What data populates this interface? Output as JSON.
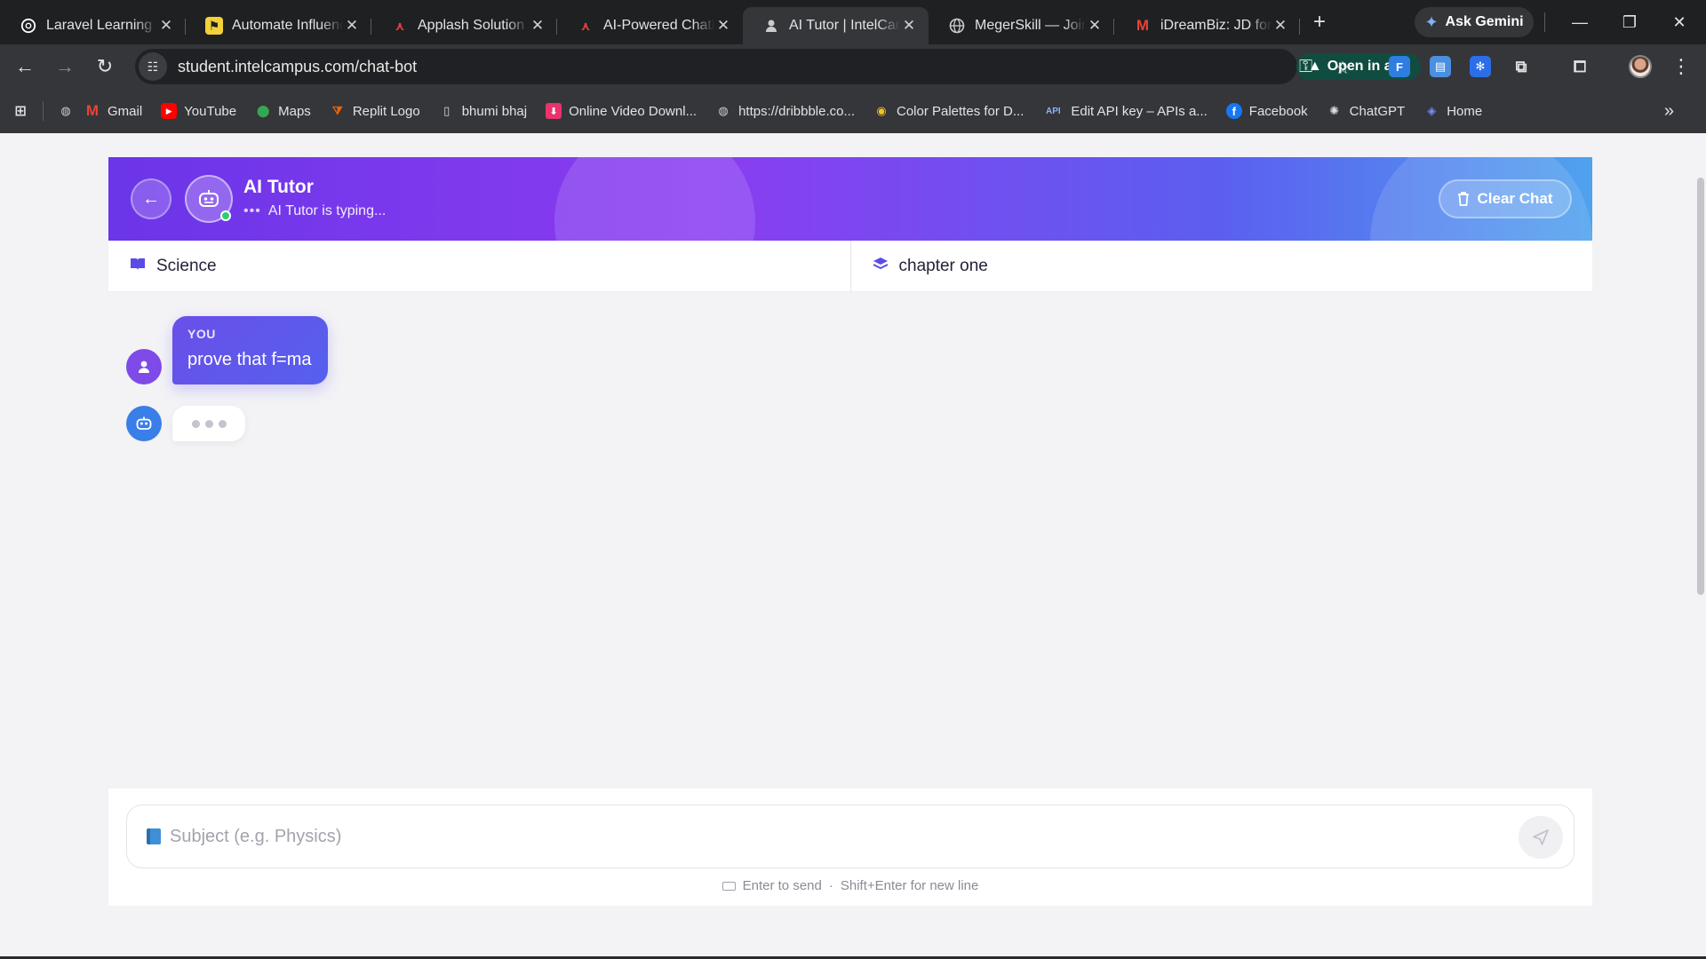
{
  "browser": {
    "tabs": [
      {
        "title": "Laravel Learning - ",
        "favicon": "chatgpt-icon",
        "color": "#ffffff"
      },
      {
        "title": "Automate Influenc",
        "favicon": "flag-icon",
        "color": "#f2d13a"
      },
      {
        "title": "Applash Solution - ",
        "favicon": "applash-icon",
        "color": "#e0413a"
      },
      {
        "title": "AI-Powered Chatb",
        "favicon": "applash-icon",
        "color": "#e0413a"
      },
      {
        "title": "AI Tutor | IntelCam",
        "favicon": "incognito-icon",
        "color": "#cccccc",
        "active": true
      },
      {
        "title": "MegerSkill — Join",
        "favicon": "globe-icon",
        "color": "#cccccc"
      },
      {
        "title": "iDreamBiz: JD for ",
        "favicon": "gmail-icon",
        "color": "#ea4335"
      }
    ],
    "gemini_label": "Ask Gemini",
    "url": "student.intelcampus.com/chat-bot",
    "open_in_app_label": "Open in app",
    "bookmarks": [
      {
        "label": "Gmail",
        "icon": "gmail-icon",
        "color": "#ea4335"
      },
      {
        "label": "YouTube",
        "icon": "youtube-icon",
        "color": "#ff0000"
      },
      {
        "label": "Maps",
        "icon": "maps-pin-icon",
        "color": "#34a853"
      },
      {
        "label": "Replit Logo",
        "icon": "replit-icon",
        "color": "#f26207"
      },
      {
        "label": "bhumi bhaj",
        "icon": "document-icon",
        "color": "#dddddd"
      },
      {
        "label": "Online Video Downl...",
        "icon": "download-icon",
        "color": "#e8336d"
      },
      {
        "label": "https://dribbble.co...",
        "icon": "globe-icon",
        "color": "#cccccc"
      },
      {
        "label": "Color Palettes for D...",
        "icon": "palette-icon",
        "color": "#f5c518"
      },
      {
        "label": "Edit API key – APIs a...",
        "icon": "api-icon",
        "color": "#8ab4f8"
      },
      {
        "label": "Facebook",
        "icon": "facebook-icon",
        "color": "#1877f2"
      },
      {
        "label": "ChatGPT",
        "icon": "chatgpt-icon",
        "color": "#dddddd"
      },
      {
        "label": "Home",
        "icon": "home-icon",
        "color": "#7b8cf0"
      }
    ]
  },
  "chat": {
    "title": "AI Tutor",
    "status": "AI Tutor is typing...",
    "clear_label": "Clear Chat",
    "subject": "Science",
    "chapter": "chapter one",
    "messages": [
      {
        "sender_label": "YOU",
        "text": "prove that f=ma"
      }
    ],
    "input_placeholder": "Subject (e.g. Physics)",
    "hint_enter": "Enter to send",
    "hint_sep": "·",
    "hint_shift": "Shift+Enter for new line"
  },
  "colors": {
    "header_gradient_start": "#6b35e8",
    "header_gradient_end": "#4fa2ee",
    "accent": "#5b4be6",
    "online": "#2ecc71"
  }
}
